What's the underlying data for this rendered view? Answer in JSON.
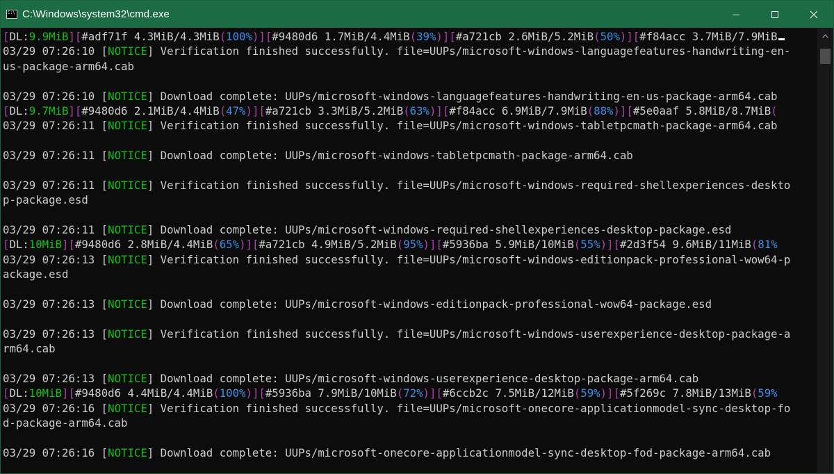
{
  "window": {
    "title": "C:\\Windows\\system32\\cmd.exe",
    "controls": {
      "minimize": "minimize-icon",
      "maximize": "maximize-icon",
      "close": "close-icon"
    }
  },
  "console": {
    "lines": [
      [
        {
          "t": "[",
          "c": "m"
        },
        {
          "t": "DL:",
          "c": "w"
        },
        {
          "t": "9.9MiB",
          "c": "g"
        },
        {
          "t": "][",
          "c": "m"
        },
        {
          "t": "#adf71f 4.3MiB/4.3MiB",
          "c": "w"
        },
        {
          "t": "(",
          "c": "m"
        },
        {
          "t": "100%",
          "c": "b"
        },
        {
          "t": ")][",
          "c": "m"
        },
        {
          "t": "#9480d6 1.7MiB/4.4MiB",
          "c": "w"
        },
        {
          "t": "(",
          "c": "m"
        },
        {
          "t": "39%",
          "c": "b"
        },
        {
          "t": ")][",
          "c": "m"
        },
        {
          "t": "#a721cb 2.6MiB/5.2MiB",
          "c": "w"
        },
        {
          "t": "(",
          "c": "m"
        },
        {
          "t": "50%",
          "c": "b"
        },
        {
          "t": ")][",
          "c": "m"
        },
        {
          "t": "#f84acc 3.7MiB/7.9MiB",
          "c": "w"
        },
        {
          "t": "",
          "c": "cursor"
        }
      ],
      [
        {
          "t": "03/29 07:26:10 [",
          "c": "w"
        },
        {
          "t": "NOTICE",
          "c": "g"
        },
        {
          "t": "] Verification finished successfully. file=UUPs/microsoft-windows-languagefeatures-handwriting-en-",
          "c": "w"
        }
      ],
      [
        {
          "t": "us-package-arm64.cab",
          "c": "w"
        }
      ],
      [],
      [
        {
          "t": "03/29 07:26:10 [",
          "c": "w"
        },
        {
          "t": "NOTICE",
          "c": "g"
        },
        {
          "t": "] Download complete: UUPs/microsoft-windows-languagefeatures-handwriting-en-us-package-arm64.cab",
          "c": "w"
        }
      ],
      [
        {
          "t": "[",
          "c": "m"
        },
        {
          "t": "DL:",
          "c": "w"
        },
        {
          "t": "9.7MiB",
          "c": "g"
        },
        {
          "t": "][",
          "c": "m"
        },
        {
          "t": "#9480d6 2.1MiB/4.4MiB",
          "c": "w"
        },
        {
          "t": "(",
          "c": "m"
        },
        {
          "t": "47%",
          "c": "b"
        },
        {
          "t": ")][",
          "c": "m"
        },
        {
          "t": "#a721cb 3.3MiB/5.2MiB",
          "c": "w"
        },
        {
          "t": "(",
          "c": "m"
        },
        {
          "t": "63%",
          "c": "b"
        },
        {
          "t": ")][",
          "c": "m"
        },
        {
          "t": "#f84acc 6.9MiB/7.9MiB",
          "c": "w"
        },
        {
          "t": "(",
          "c": "m"
        },
        {
          "t": "88%",
          "c": "b"
        },
        {
          "t": ")][",
          "c": "m"
        },
        {
          "t": "#5e0aaf 5.8MiB/8.7MiB",
          "c": "w"
        },
        {
          "t": "(",
          "c": "m"
        }
      ],
      [
        {
          "t": "03/29 07:26:11 [",
          "c": "w"
        },
        {
          "t": "NOTICE",
          "c": "g"
        },
        {
          "t": "] Verification finished successfully. file=UUPs/microsoft-windows-tabletpcmath-package-arm64.cab",
          "c": "w"
        }
      ],
      [],
      [
        {
          "t": "03/29 07:26:11 [",
          "c": "w"
        },
        {
          "t": "NOTICE",
          "c": "g"
        },
        {
          "t": "] Download complete: UUPs/microsoft-windows-tabletpcmath-package-arm64.cab",
          "c": "w"
        }
      ],
      [],
      [
        {
          "t": "03/29 07:26:11 [",
          "c": "w"
        },
        {
          "t": "NOTICE",
          "c": "g"
        },
        {
          "t": "] Verification finished successfully. file=UUPs/microsoft-windows-required-shellexperiences-deskto",
          "c": "w"
        }
      ],
      [
        {
          "t": "p-package.esd",
          "c": "w"
        }
      ],
      [],
      [
        {
          "t": "03/29 07:26:11 [",
          "c": "w"
        },
        {
          "t": "NOTICE",
          "c": "g"
        },
        {
          "t": "] Download complete: UUPs/microsoft-windows-required-shellexperiences-desktop-package.esd",
          "c": "w"
        }
      ],
      [
        {
          "t": "[",
          "c": "m"
        },
        {
          "t": "DL:",
          "c": "w"
        },
        {
          "t": "10MiB",
          "c": "g"
        },
        {
          "t": "][",
          "c": "m"
        },
        {
          "t": "#9480d6 2.8MiB/4.4MiB",
          "c": "w"
        },
        {
          "t": "(",
          "c": "m"
        },
        {
          "t": "65%",
          "c": "b"
        },
        {
          "t": ")][",
          "c": "m"
        },
        {
          "t": "#a721cb 4.9MiB/5.2MiB",
          "c": "w"
        },
        {
          "t": "(",
          "c": "m"
        },
        {
          "t": "95%",
          "c": "b"
        },
        {
          "t": ")][",
          "c": "m"
        },
        {
          "t": "#5936ba 5.9MiB/10MiB",
          "c": "w"
        },
        {
          "t": "(",
          "c": "m"
        },
        {
          "t": "55%",
          "c": "b"
        },
        {
          "t": ")][",
          "c": "m"
        },
        {
          "t": "#2d3f54 9.6MiB/11MiB",
          "c": "w"
        },
        {
          "t": "(",
          "c": "m"
        },
        {
          "t": "81%",
          "c": "b"
        }
      ],
      [
        {
          "t": "03/29 07:26:13 [",
          "c": "w"
        },
        {
          "t": "NOTICE",
          "c": "g"
        },
        {
          "t": "] Verification finished successfully. file=UUPs/microsoft-windows-editionpack-professional-wow64-p",
          "c": "w"
        }
      ],
      [
        {
          "t": "ackage.esd",
          "c": "w"
        }
      ],
      [],
      [
        {
          "t": "03/29 07:26:13 [",
          "c": "w"
        },
        {
          "t": "NOTICE",
          "c": "g"
        },
        {
          "t": "] Download complete: UUPs/microsoft-windows-editionpack-professional-wow64-package.esd",
          "c": "w"
        }
      ],
      [],
      [
        {
          "t": "03/29 07:26:13 [",
          "c": "w"
        },
        {
          "t": "NOTICE",
          "c": "g"
        },
        {
          "t": "] Verification finished successfully. file=UUPs/microsoft-windows-userexperience-desktop-package-a",
          "c": "w"
        }
      ],
      [
        {
          "t": "rm64.cab",
          "c": "w"
        }
      ],
      [],
      [
        {
          "t": "03/29 07:26:13 [",
          "c": "w"
        },
        {
          "t": "NOTICE",
          "c": "g"
        },
        {
          "t": "] Download complete: UUPs/microsoft-windows-userexperience-desktop-package-arm64.cab",
          "c": "w"
        }
      ],
      [
        {
          "t": "[",
          "c": "m"
        },
        {
          "t": "DL:",
          "c": "w"
        },
        {
          "t": "10MiB",
          "c": "g"
        },
        {
          "t": "][",
          "c": "m"
        },
        {
          "t": "#9480d6 4.4MiB/4.4MiB",
          "c": "w"
        },
        {
          "t": "(",
          "c": "m"
        },
        {
          "t": "100%",
          "c": "b"
        },
        {
          "t": ")][",
          "c": "m"
        },
        {
          "t": "#5936ba 7.9MiB/10MiB",
          "c": "w"
        },
        {
          "t": "(",
          "c": "m"
        },
        {
          "t": "72%",
          "c": "b"
        },
        {
          "t": ")][",
          "c": "m"
        },
        {
          "t": "#6ccb2c 7.5MiB/12MiB",
          "c": "w"
        },
        {
          "t": "(",
          "c": "m"
        },
        {
          "t": "59%",
          "c": "b"
        },
        {
          "t": ")][",
          "c": "m"
        },
        {
          "t": "#5f269c 7.8MiB/13MiB",
          "c": "w"
        },
        {
          "t": "(",
          "c": "m"
        },
        {
          "t": "59%",
          "c": "b"
        }
      ],
      [
        {
          "t": "03/29 07:26:16 [",
          "c": "w"
        },
        {
          "t": "NOTICE",
          "c": "g"
        },
        {
          "t": "] Verification finished successfully. file=UUPs/microsoft-onecore-applicationmodel-sync-desktop-fo",
          "c": "w"
        }
      ],
      [
        {
          "t": "d-package-arm64.cab",
          "c": "w"
        }
      ],
      [],
      [
        {
          "t": "03/29 07:26:16 [",
          "c": "w"
        },
        {
          "t": "NOTICE",
          "c": "g"
        },
        {
          "t": "] Download complete: UUPs/microsoft-onecore-applicationmodel-sync-desktop-fod-package-arm64.cab",
          "c": "w"
        }
      ]
    ]
  },
  "colors": {
    "titlebar": "#1b6b45",
    "background": "#0c0c0c",
    "text": "#cccccc",
    "notice": "#13c013",
    "bracket": "#b042b0",
    "percent": "#3b8eea"
  }
}
